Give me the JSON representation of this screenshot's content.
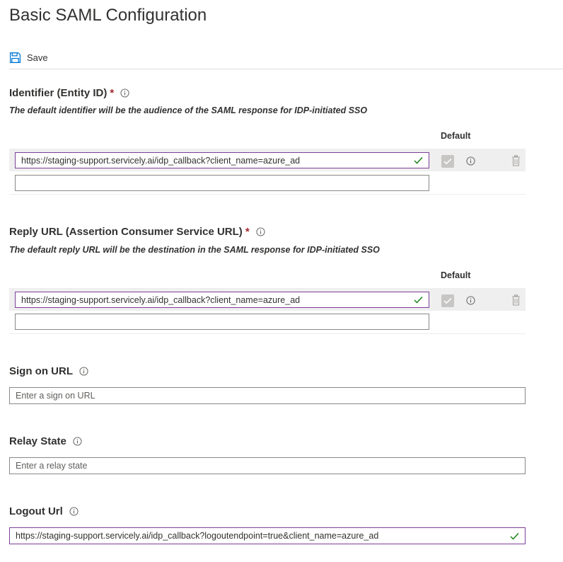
{
  "page": {
    "title": "Basic SAML Configuration"
  },
  "toolbar": {
    "save_label": "Save"
  },
  "identifier": {
    "title": "Identifier (Entity ID)",
    "required_mark": "*",
    "description": "The default identifier will be the audience of the SAML response for IDP-initiated SSO",
    "default_column": "Default",
    "rows": [
      {
        "value": "https://staging-support.servicely.ai/idp_callback?client_name=azure_ad",
        "is_default": true
      }
    ],
    "new_value": ""
  },
  "reply_url": {
    "title": "Reply URL (Assertion Consumer Service URL)",
    "required_mark": "*",
    "description": "The default reply URL will be the destination in the SAML response for IDP-initiated SSO",
    "default_column": "Default",
    "rows": [
      {
        "value": "https://staging-support.servicely.ai/idp_callback?client_name=azure_ad",
        "is_default": true
      }
    ],
    "new_value": ""
  },
  "sign_on_url": {
    "title": "Sign on URL",
    "placeholder": "Enter a sign on URL",
    "value": ""
  },
  "relay_state": {
    "title": "Relay State",
    "placeholder": "Enter a relay state",
    "value": ""
  },
  "logout_url": {
    "title": "Logout Url",
    "value": "https://staging-support.servicely.ai/idp_callback?logoutendpoint=true&client_name=azure_ad"
  },
  "icons": {
    "save": "save-icon",
    "info": "info-icon",
    "valid": "checkmark-icon",
    "delete": "delete-icon",
    "checkbox": "checkbox-checked-icon"
  },
  "colors": {
    "accent_border": "#7e3f98",
    "valid_check": "#107c10",
    "required": "#a4262c",
    "row_background": "#efefef",
    "disabled_checkbox": "#c8c6c4"
  }
}
